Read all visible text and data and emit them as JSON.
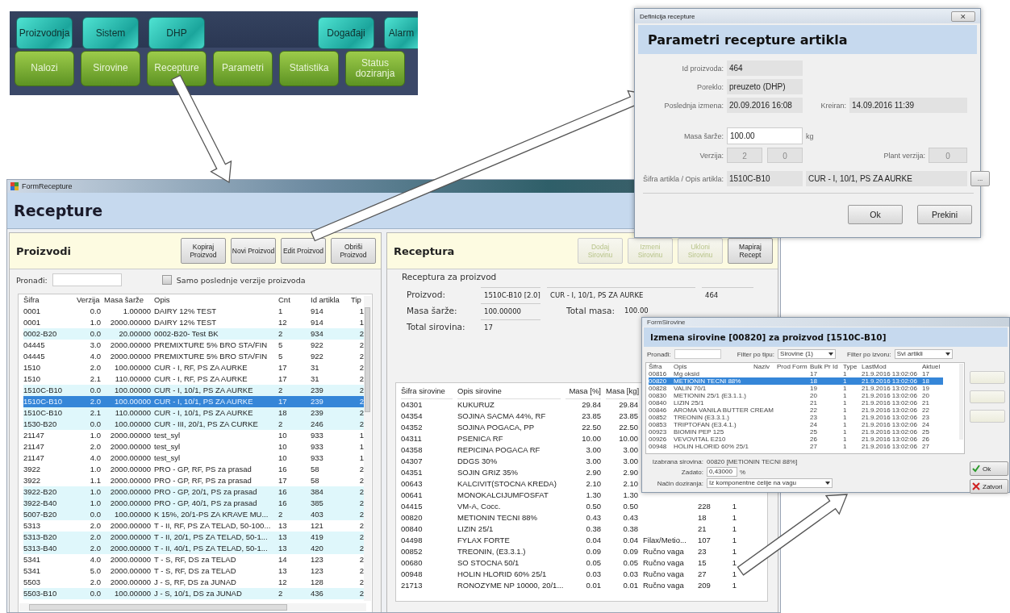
{
  "menu": {
    "top_left_buttons": [
      "Proizvodnja",
      "Sistem",
      "DHP"
    ],
    "top_right_buttons": [
      "Događaji",
      "Alarm"
    ],
    "bottom_buttons": [
      "Nalozi",
      "Sirovine",
      "Recepture",
      "Parametri",
      "Statistika",
      "Status doziranja"
    ]
  },
  "recepture_window": {
    "title": "FormRecepture",
    "header": "Recepture",
    "products": {
      "title": "Proizvodi",
      "buttons": [
        "Kopiraj Proizvod",
        "Novi Proizvod",
        "Edit Proizvod",
        "Obriši Proizvod"
      ],
      "search_label": "Pronađi:",
      "latest_only": {
        "label": "Samo poslednje verzije proizvoda",
        "checked": false
      },
      "columns": [
        "Šifra",
        "Verzija",
        "Masa šarže",
        "Opis",
        "Cnt",
        "Id artikla",
        "Tip"
      ],
      "rows": [
        {
          "cells": [
            "0001",
            "0.0",
            "1.00000",
            "DAIRY 12% TEST",
            "1",
            "914",
            "1"
          ],
          "highlighted": false,
          "selected": false
        },
        {
          "cells": [
            "0001",
            "1.0",
            "2000.00000",
            "DAIRY 12% TEST",
            "12",
            "914",
            "1"
          ],
          "highlighted": false,
          "selected": false
        },
        {
          "cells": [
            "0002-B20",
            "0.0",
            "20.00000",
            "0002-B20- Test BK",
            "2",
            "934",
            "2"
          ],
          "highlighted": true,
          "selected": false
        },
        {
          "cells": [
            "04445",
            "3.0",
            "2000.00000",
            "PREMIXTURE 5% BRO STA/FIN",
            "5",
            "922",
            "2"
          ],
          "highlighted": false,
          "selected": false
        },
        {
          "cells": [
            "04445",
            "4.0",
            "2000.00000",
            "PREMIXTURE 5% BRO STA/FIN",
            "5",
            "922",
            "2"
          ],
          "highlighted": false,
          "selected": false
        },
        {
          "cells": [
            "1510",
            "2.0",
            "100.00000",
            "CUR - I, RF, PS ZA AURKE",
            "17",
            "31",
            "2"
          ],
          "highlighted": false,
          "selected": false
        },
        {
          "cells": [
            "1510",
            "2.1",
            "110.00000",
            "CUR - I, RF, PS ZA AURKE",
            "17",
            "31",
            "2"
          ],
          "highlighted": false,
          "selected": false
        },
        {
          "cells": [
            "1510C-B10",
            "0.0",
            "100.00000",
            "CUR - I, 10/1, PS ZA AURKE",
            "2",
            "239",
            "2"
          ],
          "highlighted": true,
          "selected": false
        },
        {
          "cells": [
            "1510C-B10",
            "2.0",
            "100.00000",
            "CUR - I, 10/1, PS ZA AURKE",
            "17",
            "239",
            "2"
          ],
          "highlighted": true,
          "selected": true
        },
        {
          "cells": [
            "1510C-B10",
            "2.1",
            "110.00000",
            "CUR - I, 10/1, PS ZA AURKE",
            "18",
            "239",
            "2"
          ],
          "highlighted": true,
          "selected": false
        },
        {
          "cells": [
            "1530-B20",
            "0.0",
            "100.00000",
            "CUR - III, 20/1, PS ZA CURKE",
            "2",
            "246",
            "2"
          ],
          "highlighted": true,
          "selected": false
        },
        {
          "cells": [
            "21147",
            "1.0",
            "2000.00000",
            "test_syl",
            "10",
            "933",
            "1"
          ],
          "highlighted": false,
          "selected": false
        },
        {
          "cells": [
            "21147",
            "2.0",
            "2000.00000",
            "test_syl",
            "10",
            "933",
            "1"
          ],
          "highlighted": false,
          "selected": false
        },
        {
          "cells": [
            "21147",
            "4.0",
            "2000.00000",
            "test_syl",
            "10",
            "933",
            "1"
          ],
          "highlighted": false,
          "selected": false
        },
        {
          "cells": [
            "3922",
            "1.0",
            "2000.00000",
            "PRO - GP, RF, PS za prasad",
            "16",
            "58",
            "2"
          ],
          "highlighted": false,
          "selected": false
        },
        {
          "cells": [
            "3922",
            "1.1",
            "2000.00000",
            "PRO - GP, RF, PS za prasad",
            "17",
            "58",
            "2"
          ],
          "highlighted": false,
          "selected": false
        },
        {
          "cells": [
            "3922-B20",
            "1.0",
            "2000.00000",
            "PRO - GP, 20/1, PS za prasad",
            "16",
            "384",
            "2"
          ],
          "highlighted": true,
          "selected": false
        },
        {
          "cells": [
            "3922-B40",
            "1.0",
            "2000.00000",
            "PRO - GP, 40/1, PS za prasad",
            "16",
            "385",
            "2"
          ],
          "highlighted": true,
          "selected": false
        },
        {
          "cells": [
            "5007-B20",
            "0.0",
            "100.00000",
            "K 15%, 20/1-PS ZA KRAVE MU...",
            "2",
            "403",
            "2"
          ],
          "highlighted": true,
          "selected": false
        },
        {
          "cells": [
            "5313",
            "2.0",
            "2000.00000",
            "T - II, RF, PS ZA TELAD, 50-100...",
            "13",
            "121",
            "2"
          ],
          "highlighted": false,
          "selected": false
        },
        {
          "cells": [
            "5313-B20",
            "2.0",
            "2000.00000",
            "T - II, 20/1, PS ZA TELAD, 50-1...",
            "13",
            "419",
            "2"
          ],
          "highlighted": true,
          "selected": false
        },
        {
          "cells": [
            "5313-B40",
            "2.0",
            "2000.00000",
            "T - II, 40/1, PS ZA TELAD, 50-1...",
            "13",
            "420",
            "2"
          ],
          "highlighted": true,
          "selected": false
        },
        {
          "cells": [
            "5341",
            "4.0",
            "2000.00000",
            "T - S, RF, DS za TELAD",
            "14",
            "123",
            "2"
          ],
          "highlighted": false,
          "selected": false
        },
        {
          "cells": [
            "5341",
            "5.0",
            "2000.00000",
            "T - S, RF, DS za TELAD",
            "13",
            "123",
            "2"
          ],
          "highlighted": false,
          "selected": false
        },
        {
          "cells": [
            "5503",
            "2.0",
            "2000.00000",
            "J - S, RF, DS za JUNAD",
            "12",
            "128",
            "2"
          ],
          "highlighted": false,
          "selected": false
        },
        {
          "cells": [
            "5503-B10",
            "0.0",
            "100.00000",
            "J - S, 10/1, DS za JUNAD",
            "2",
            "436",
            "2"
          ],
          "highlighted": true,
          "selected": false
        }
      ]
    },
    "recipe": {
      "title": "Receptura",
      "buttons": [
        {
          "label": "Dodaj Sirovinu",
          "disabled": true
        },
        {
          "label": "Izmeni Sirovinu",
          "disabled": true
        },
        {
          "label": "Ukloni Sirovinu",
          "disabled": true
        },
        {
          "label": "Mapiraj Recept",
          "disabled": false
        }
      ],
      "group_title": "Receptura za proizvod",
      "product_label": "Proizvod:",
      "product_code": "1510C-B10 [2.0]",
      "product_name": "CUR - I, 10/1, PS ZA AURKE",
      "product_id": "464",
      "batch_label": "Masa šarže:",
      "batch_value": "100.00000",
      "total_mass_label": "Total masa:",
      "total_mass_value": "100.00",
      "count_label": "Total sirovina:",
      "count_value": "17",
      "columns": [
        "Šifra sirovine",
        "Opis sirovine",
        "Masa [%]",
        "Masa [kg]"
      ],
      "rows": [
        {
          "code": "04301",
          "name": "KUKURUZ",
          "pct": "29.84",
          "kg": "29.84"
        },
        {
          "code": "04354",
          "name": "SOJINA SACMA 44%,  RF",
          "pct": "23.85",
          "kg": "23.85"
        },
        {
          "code": "04352",
          "name": "SOJINA POGACA,  PP",
          "pct": "22.50",
          "kg": "22.50"
        },
        {
          "code": "04311",
          "name": "PSENICA RF",
          "pct": "10.00",
          "kg": "10.00"
        },
        {
          "code": "04358",
          "name": "REPICINA POGACA RF",
          "pct": "3.00",
          "kg": "3.00"
        },
        {
          "code": "04307",
          "name": "DDGS 30%",
          "pct": "3.00",
          "kg": "3.00"
        },
        {
          "code": "04351",
          "name": "SOJIN GRIZ 35%",
          "pct": "2.90",
          "kg": "2.90"
        },
        {
          "code": "00643",
          "name": "KALCIVIT(STOCNA KREDA)",
          "pct": "2.10",
          "kg": "2.10"
        },
        {
          "code": "00641",
          "name": "MONOKALCIJUMFOSFAT",
          "pct": "1.30",
          "kg": "1.30"
        },
        {
          "code": "04415",
          "name": "VM-A,  Cocc.",
          "pct": "0.50",
          "kg": "0.50",
          "column_6": "228",
          "column_7": "1"
        },
        {
          "code": "00820",
          "name": "METIONIN TECNI 88%",
          "pct": "0.43",
          "kg": "0.43",
          "column_6": "18",
          "column_7": "1"
        },
        {
          "code": "00840",
          "name": "LIZIN 25/1",
          "pct": "0.38",
          "kg": "0.38",
          "column_6": "21",
          "column_7": "1"
        },
        {
          "code": "04498",
          "name": "FYLAX FORTE",
          "pct": "0.04",
          "kg": "0.04",
          "column_5": "Filax/Metio...",
          "column_6": "107",
          "column_7": "1"
        },
        {
          "code": "00852",
          "name": "TREONIN, (E3.3.1.)",
          "pct": "0.09",
          "kg": "0.09",
          "column_5": "Ručno vaga",
          "column_6": "23",
          "column_7": "1"
        },
        {
          "code": "00680",
          "name": "SO STOCNA 50/1",
          "pct": "0.05",
          "kg": "0.05",
          "column_5": "Ručno vaga",
          "column_6": "15",
          "column_7": "1"
        },
        {
          "code": "00948",
          "name": "HOLIN HLORID 60%  25/1",
          "pct": "0.03",
          "kg": "0.03",
          "column_5": "Ručno vaga",
          "column_6": "27",
          "column_7": "1"
        },
        {
          "code": "21713",
          "name": "RONOZYME NP 10000, 20/1...",
          "pct": "0.01",
          "kg": "0.01",
          "column_5": "Ručno vaga",
          "column_6": "209",
          "column_7": "1"
        }
      ]
    }
  },
  "params_dialog": {
    "title": "Definicija recepture",
    "close_label": "⨯",
    "header": "Parametri recepture artikla",
    "id_label": "Id proizvoda:",
    "id_value": "464",
    "origin_label": "Poreklo:",
    "origin_value": "preuzeto (DHP)",
    "modified_label": "Poslednja izmena:",
    "modified_value": "20.09.2016 16:08",
    "created_label": "Kreiran:",
    "created_value": "14.09.2016 11:39",
    "batch_label": "Masa šarže:",
    "batch_value": "100.00",
    "batch_unit": "kg",
    "version_label": "Verzija:",
    "version_major": "2",
    "version_minor": "0",
    "plant_version_label": "Plant verzija:",
    "plant_version_value": "0",
    "article_label": "Šifra artikla / Opis artikla:",
    "article_code": "1510C-B10",
    "article_name": "CUR - I, 10/1, PS ZA AURKE",
    "browse_label": "...",
    "ok_label": "Ok",
    "cancel_label": "Prekini"
  },
  "sirovine_dialog": {
    "title": "FormSirovine",
    "header": "Izmena sirovine [00820] za proizvod [1510C-B10]",
    "search_label": "Pronađi:",
    "type_filter_label": "Filter po tipu:",
    "type_filter_value": "Sirovine (1)",
    "source_filter_label": "Filter po izvoru:",
    "source_filter_value": "Svi artikli",
    "columns": [
      "Šifra",
      "Opis",
      "Naziv",
      "Prod Form",
      "Bulk Pr Id",
      "Type",
      "LastMod",
      "Aktuel"
    ],
    "rows": [
      {
        "cells": [
          "00816",
          "Mg oksid",
          "",
          "",
          "17",
          "1",
          "21.9.2016 13:02:06",
          "17"
        ],
        "selected": false
      },
      {
        "cells": [
          "00820",
          "METIONIN TECNI 88%",
          "",
          "",
          "18",
          "1",
          "21.9.2016 13:02:06",
          "18"
        ],
        "selected": true
      },
      {
        "cells": [
          "00828",
          "VALIN 70/1",
          "",
          "",
          "19",
          "1",
          "21.9.2016 13:02:06",
          "19"
        ],
        "selected": false
      },
      {
        "cells": [
          "00830",
          "METIONIN 25/1 (E3.1.1.)",
          "",
          "",
          "20",
          "1",
          "21.9.2016 13:02:06",
          "20"
        ],
        "selected": false
      },
      {
        "cells": [
          "00840",
          "LIZIN 25/1",
          "",
          "",
          "21",
          "1",
          "21.9.2016 13:02:06",
          "21"
        ],
        "selected": false
      },
      {
        "cells": [
          "00846",
          "AROMA VANILA BUTTER CREAM",
          "",
          "",
          "22",
          "1",
          "21.9.2016 13:02:06",
          "22"
        ],
        "selected": false
      },
      {
        "cells": [
          "00852",
          "TREONIN (E3.3.1.)",
          "",
          "",
          "23",
          "1",
          "21.9.2016 13:02:06",
          "23"
        ],
        "selected": false
      },
      {
        "cells": [
          "00853",
          "TRIPTOFAN (E3.4.1.)",
          "",
          "",
          "24",
          "1",
          "21.9.2016 13:02:06",
          "24"
        ],
        "selected": false
      },
      {
        "cells": [
          "00923",
          "BIOMIN PEP 125",
          "",
          "",
          "25",
          "1",
          "21.9.2016 13:02:06",
          "25"
        ],
        "selected": false
      },
      {
        "cells": [
          "00926",
          "VEVOVITAL E210",
          "",
          "",
          "26",
          "1",
          "21.9.2016 13:02:06",
          "26"
        ],
        "selected": false
      },
      {
        "cells": [
          "00948",
          "HOLIN HLORID 60% 25/1",
          "",
          "",
          "27",
          "1",
          "21.9.2016 13:02:06",
          "27"
        ],
        "selected": false
      }
    ],
    "selected_label": "Izabrana sirovina:",
    "selected_value": "00820 [METIONIN TECNI 88%]",
    "set_label": "Zadato:",
    "set_value": "0,43000",
    "set_unit": "%",
    "mode_label": "Način doziranja:",
    "mode_value": "Iz komponentne ćelije na vagu",
    "side_buttons": [
      {
        "disabled": true
      },
      {
        "disabled": true
      },
      {
        "disabled": true
      }
    ],
    "ok_label": "Ok",
    "cancel_label": "Zatvori"
  }
}
